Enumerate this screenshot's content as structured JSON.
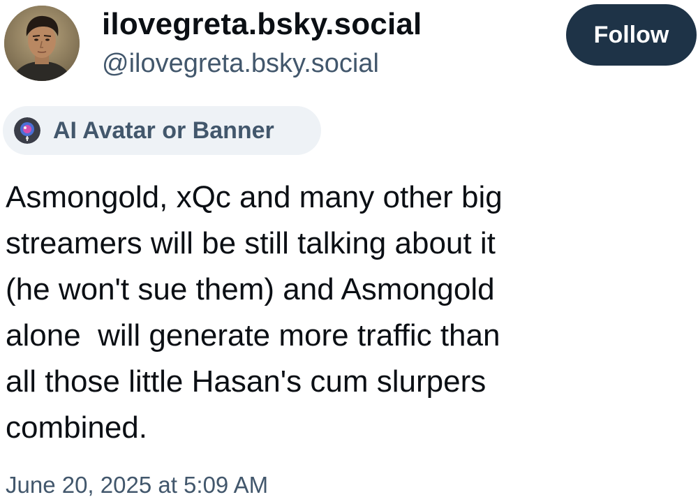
{
  "author": {
    "display_name": "ilovegreta.bsky.social",
    "handle": "@ilovegreta.bsky.social"
  },
  "actions": {
    "follow_label": "Follow"
  },
  "label": {
    "text": "AI Avatar or Banner",
    "icon": "labeler-avatar-icon"
  },
  "post": {
    "lines": [
      "Asmongold, xQc and many other big",
      "streamers will be still talking about it",
      "(he won't sue them) and Asmongold",
      "alone  will generate more traffic than",
      "all those little Hasan's cum slurpers",
      "combined."
    ],
    "timestamp": "June 20, 2025 at 5:09 AM"
  },
  "colors": {
    "follow_button_bg": "#1e3347",
    "secondary_text": "#42576c",
    "chip_bg": "#eef2f6"
  }
}
